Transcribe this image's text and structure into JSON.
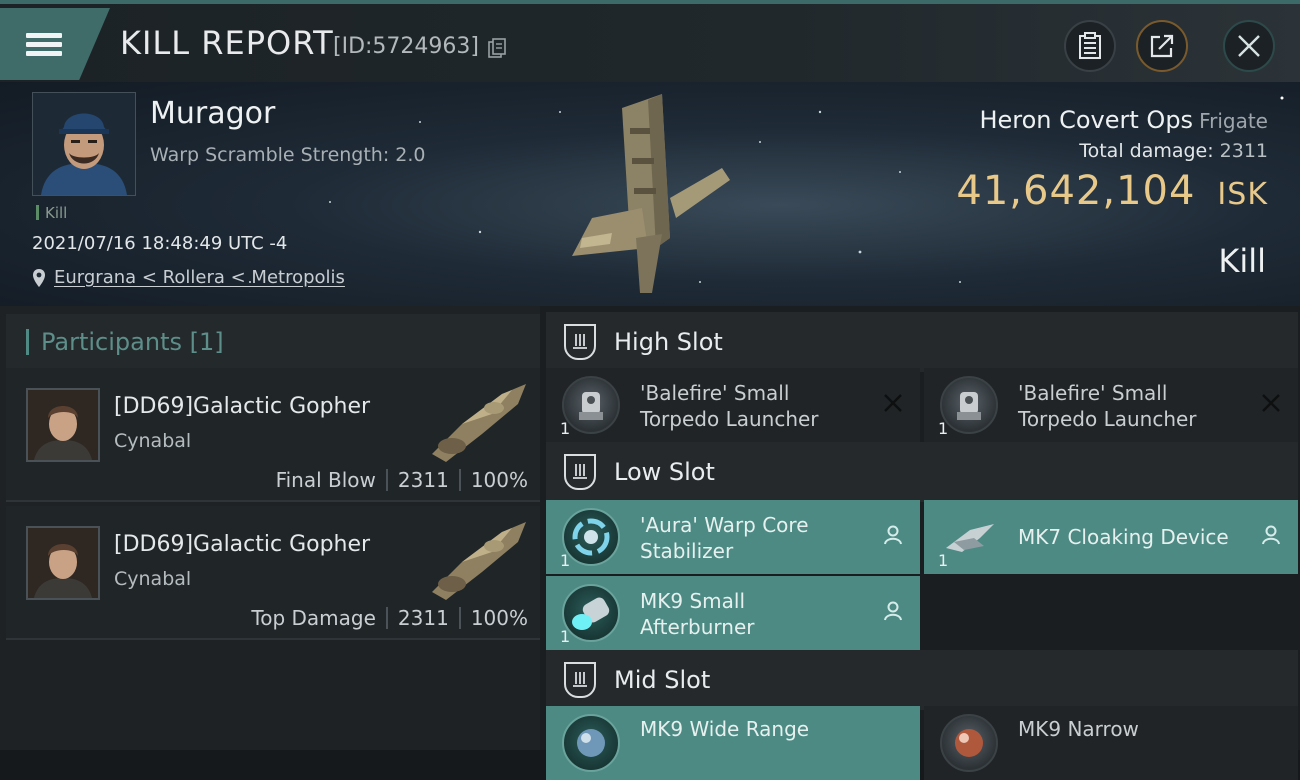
{
  "topbar": {
    "title": "KILL REPORT",
    "report_id": "[ID:5724963]"
  },
  "victim": {
    "name": "Muragor",
    "subtitle": "Warp Scramble Strength: 2.0",
    "kill_tag": "Kill",
    "timestamp": "2021/07/16 18:48:49 UTC -4",
    "location": "Eurgrana < Rollera < Metropolis",
    "ship_name": "Heron Covert Ops",
    "ship_class": "Frigate",
    "damage_label": "Total damage:",
    "damage_value": "2311",
    "isk_value": "41,642,104",
    "isk_unit": "ISK",
    "result": "Kill"
  },
  "participants": {
    "header": "Participants [1]",
    "rows": [
      {
        "name": "[DD69]Galactic Gopher",
        "ship": "Cynabal",
        "role": "Final Blow",
        "damage": "2311",
        "percent": "100%"
      },
      {
        "name": "[DD69]Galactic Gopher",
        "ship": "Cynabal",
        "role": "Top Damage",
        "damage": "2311",
        "percent": "100%"
      }
    ]
  },
  "fitting": {
    "high_slot": {
      "label": "High Slot",
      "modules": [
        {
          "name_line1": "'Balefire' Small",
          "name_line2": "Torpedo Launcher",
          "qty": "1"
        },
        {
          "name_line1": "'Balefire' Small",
          "name_line2": "Torpedo Launcher",
          "qty": "1"
        }
      ]
    },
    "low_slot": {
      "label": "Low Slot",
      "modules": [
        {
          "name_line1": "'Aura' Warp Core",
          "name_line2": "Stabilizer",
          "qty": "1"
        },
        {
          "name_line1": "MK7 Cloaking Device",
          "name_line2": "",
          "qty": "1"
        },
        {
          "name_line1": "MK9 Small",
          "name_line2": "Afterburner",
          "qty": "1"
        }
      ]
    },
    "mid_slot": {
      "label": "Mid Slot",
      "modules": [
        {
          "name_line1": "MK9 Wide Range",
          "name_line2": "",
          "qty": ""
        },
        {
          "name_line1": "MK9 Narrow",
          "name_line2": "",
          "qty": ""
        }
      ]
    }
  },
  "colors": {
    "accent_teal": "#4d8a84",
    "isk_gold": "#e8c98a"
  }
}
